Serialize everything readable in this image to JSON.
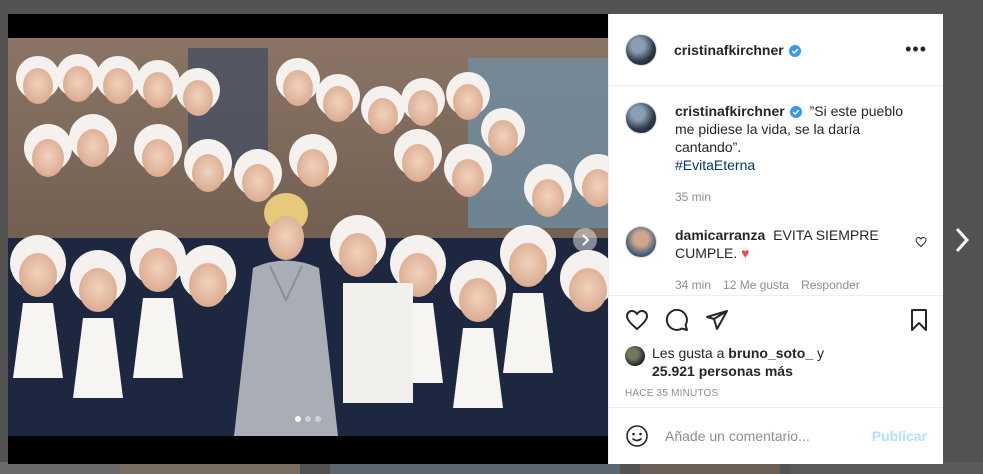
{
  "post": {
    "username": "cristinafkirchner",
    "caption_text": "”Si este pueblo me pidiese la vida, se la daría cantando”.",
    "caption_hashtag": "#EvitaEterna",
    "caption_time": "35 min"
  },
  "comment": {
    "username": "damicarranza",
    "text": "EVITA SIEMPRE CUMPLE.",
    "emoji": "♥",
    "time": "34 min",
    "likes": "12 Me gusta",
    "reply": "Responder"
  },
  "likes": {
    "prefix": "Les gusta a",
    "user": "bruno_soto_",
    "and": "y",
    "others": "25.921 personas más"
  },
  "timestamp": "HACE 35 MINUTOS",
  "add_comment": {
    "placeholder": "Añade un comentario...",
    "publish_label": "Publicar"
  },
  "more_label": "•••",
  "carousel": {
    "total": 3,
    "active": 1
  },
  "colors": {
    "accent": "#3897f0",
    "text": "#262626",
    "muted": "#8e8e8e",
    "heart": "#ed4956"
  }
}
